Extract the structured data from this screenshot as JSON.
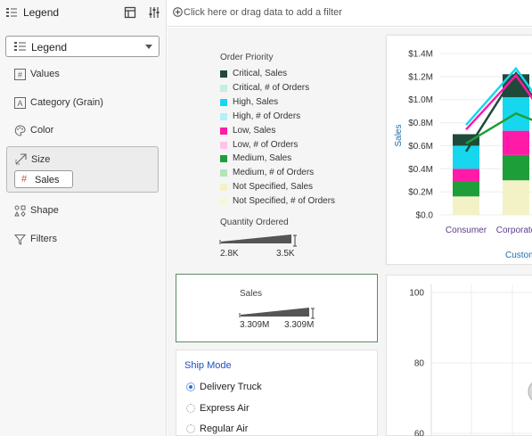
{
  "panel": {
    "title": "Legend",
    "legend_select": "Legend",
    "items": {
      "values": "Values",
      "category": "Category (Grain)",
      "color": "Color",
      "size": "Size",
      "size_pill": "Sales",
      "shape": "Shape",
      "filters": "Filters"
    }
  },
  "filter_bar": {
    "placeholder": "Click here or drag data to add a filter"
  },
  "legend": {
    "title": "Order Priority",
    "items": [
      {
        "label": "Critical, Sales",
        "color": "#1f4a3a"
      },
      {
        "label": "Critical, # of Orders",
        "color": "#c3f0dc"
      },
      {
        "label": "High, Sales",
        "color": "#16d7ee"
      },
      {
        "label": "High, # of Orders",
        "color": "#b4f0f8"
      },
      {
        "label": "Low, Sales",
        "color": "#ff1aa8"
      },
      {
        "label": "Low, # of Orders",
        "color": "#ffc3ea"
      },
      {
        "label": "Medium, Sales",
        "color": "#1e9e38"
      },
      {
        "label": "Medium, # of Orders",
        "color": "#b2e6b9"
      },
      {
        "label": "Not Specified, Sales",
        "color": "#f2f2c6"
      },
      {
        "label": "Not Specified, # of Orders",
        "color": "#f6f6dc"
      }
    ],
    "qty_title": "Quantity Ordered",
    "qty_min": "2.8K",
    "qty_max": "3.5K"
  },
  "sales_legend": {
    "title": "Sales",
    "min": "3.309M",
    "max": "3.309M"
  },
  "ship_mode": {
    "title": "Ship Mode",
    "options": [
      "Delivery Truck",
      "Express Air",
      "Regular Air"
    ],
    "selected": "Delivery Truck"
  },
  "chart_data": [
    {
      "type": "bar",
      "stacked": true,
      "categories": [
        "Consumer",
        "Corporate"
      ],
      "ylabel": "Sales",
      "xlabel": "Custom",
      "y_ticks": [
        "$0.0",
        "$0.2M",
        "$0.4M",
        "$0.6M",
        "$0.8M",
        "$1.0M",
        "$1.2M",
        "$1.4M"
      ],
      "ylim": [
        0,
        1400000
      ],
      "series": [
        {
          "name": "Not Specified, Sales",
          "values": [
            160000,
            300000
          ]
        },
        {
          "name": "Medium, Sales",
          "values": [
            130000,
            220000
          ]
        },
        {
          "name": "Low, Sales",
          "values": [
            110000,
            210000
          ]
        },
        {
          "name": "High, Sales",
          "values": [
            200000,
            290000
          ]
        },
        {
          "name": "Critical, Sales",
          "values": [
            100000,
            200000
          ]
        }
      ],
      "lines": [
        {
          "name": "High, # of Orders",
          "color": "#16d7ee",
          "values": [
            780000,
            1270000
          ]
        },
        {
          "name": "Critical, # of Orders",
          "color": "#1f4a3a",
          "values": [
            550000,
            1230000
          ]
        },
        {
          "name": "Medium, # of Orders",
          "color": "#1e9e38",
          "values": [
            620000,
            880000
          ]
        },
        {
          "name": "Low, # of Orders",
          "color": "#ff1aa8",
          "values": [
            740000,
            1210000
          ]
        }
      ]
    },
    {
      "type": "scatter",
      "y_ticks": [
        "100",
        "80",
        "60"
      ],
      "ylim": [
        60,
        100
      ]
    }
  ]
}
